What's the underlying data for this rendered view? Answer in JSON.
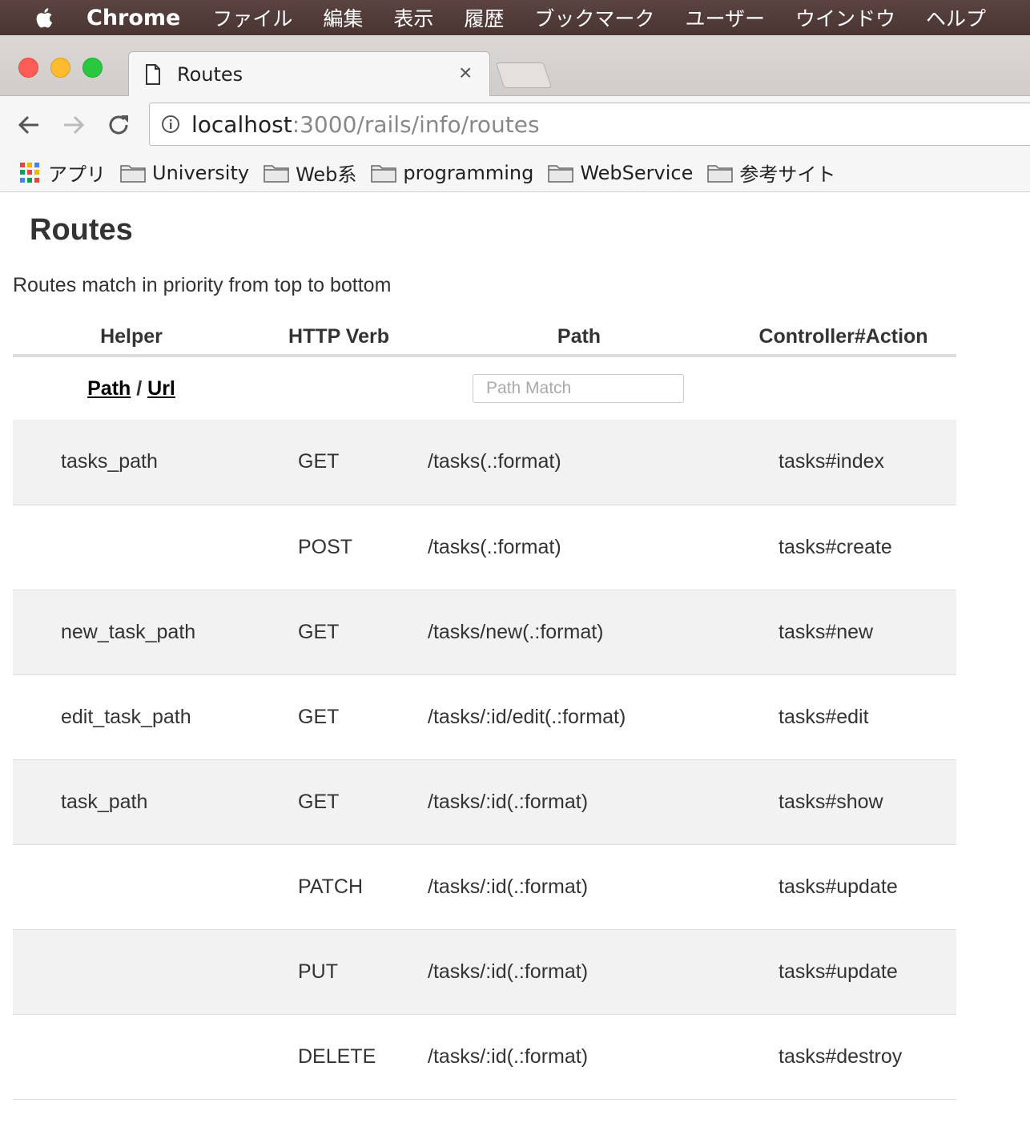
{
  "menubar": {
    "app": "Chrome",
    "items": [
      "ファイル",
      "編集",
      "表示",
      "履歴",
      "ブックマーク",
      "ユーザー",
      "ウインドウ",
      "ヘルプ"
    ]
  },
  "tab": {
    "title": "Routes",
    "close": "×"
  },
  "omnibox": {
    "host": "localhost",
    "rest": ":3000/rails/info/routes"
  },
  "bookmarks": {
    "apps_label": "アプリ",
    "folders": [
      "University",
      "Web系",
      "programming",
      "WebService",
      "参考サイト"
    ]
  },
  "page": {
    "title": "Routes",
    "description": "Routes match in priority from top to bottom"
  },
  "table": {
    "headers": {
      "helper": "Helper",
      "verb": "HTTP Verb",
      "path": "Path",
      "controller": "Controller#Action"
    },
    "filter": {
      "path_link": "Path",
      "separator": " / ",
      "url_link": "Url",
      "path_match_placeholder": "Path Match"
    },
    "rows": [
      {
        "helper": "tasks_path",
        "verb": "GET",
        "path": "/tasks(.:format)",
        "controller": "tasks#index"
      },
      {
        "helper": "",
        "verb": "POST",
        "path": "/tasks(.:format)",
        "controller": "tasks#create"
      },
      {
        "helper": "new_task_path",
        "verb": "GET",
        "path": "/tasks/new(.:format)",
        "controller": "tasks#new"
      },
      {
        "helper": "edit_task_path",
        "verb": "GET",
        "path": "/tasks/:id/edit(.:format)",
        "controller": "tasks#edit"
      },
      {
        "helper": "task_path",
        "verb": "GET",
        "path": "/tasks/:id(.:format)",
        "controller": "tasks#show"
      },
      {
        "helper": "",
        "verb": "PATCH",
        "path": "/tasks/:id(.:format)",
        "controller": "tasks#update"
      },
      {
        "helper": "",
        "verb": "PUT",
        "path": "/tasks/:id(.:format)",
        "controller": "tasks#update"
      },
      {
        "helper": "",
        "verb": "DELETE",
        "path": "/tasks/:id(.:format)",
        "controller": "tasks#destroy"
      }
    ]
  }
}
